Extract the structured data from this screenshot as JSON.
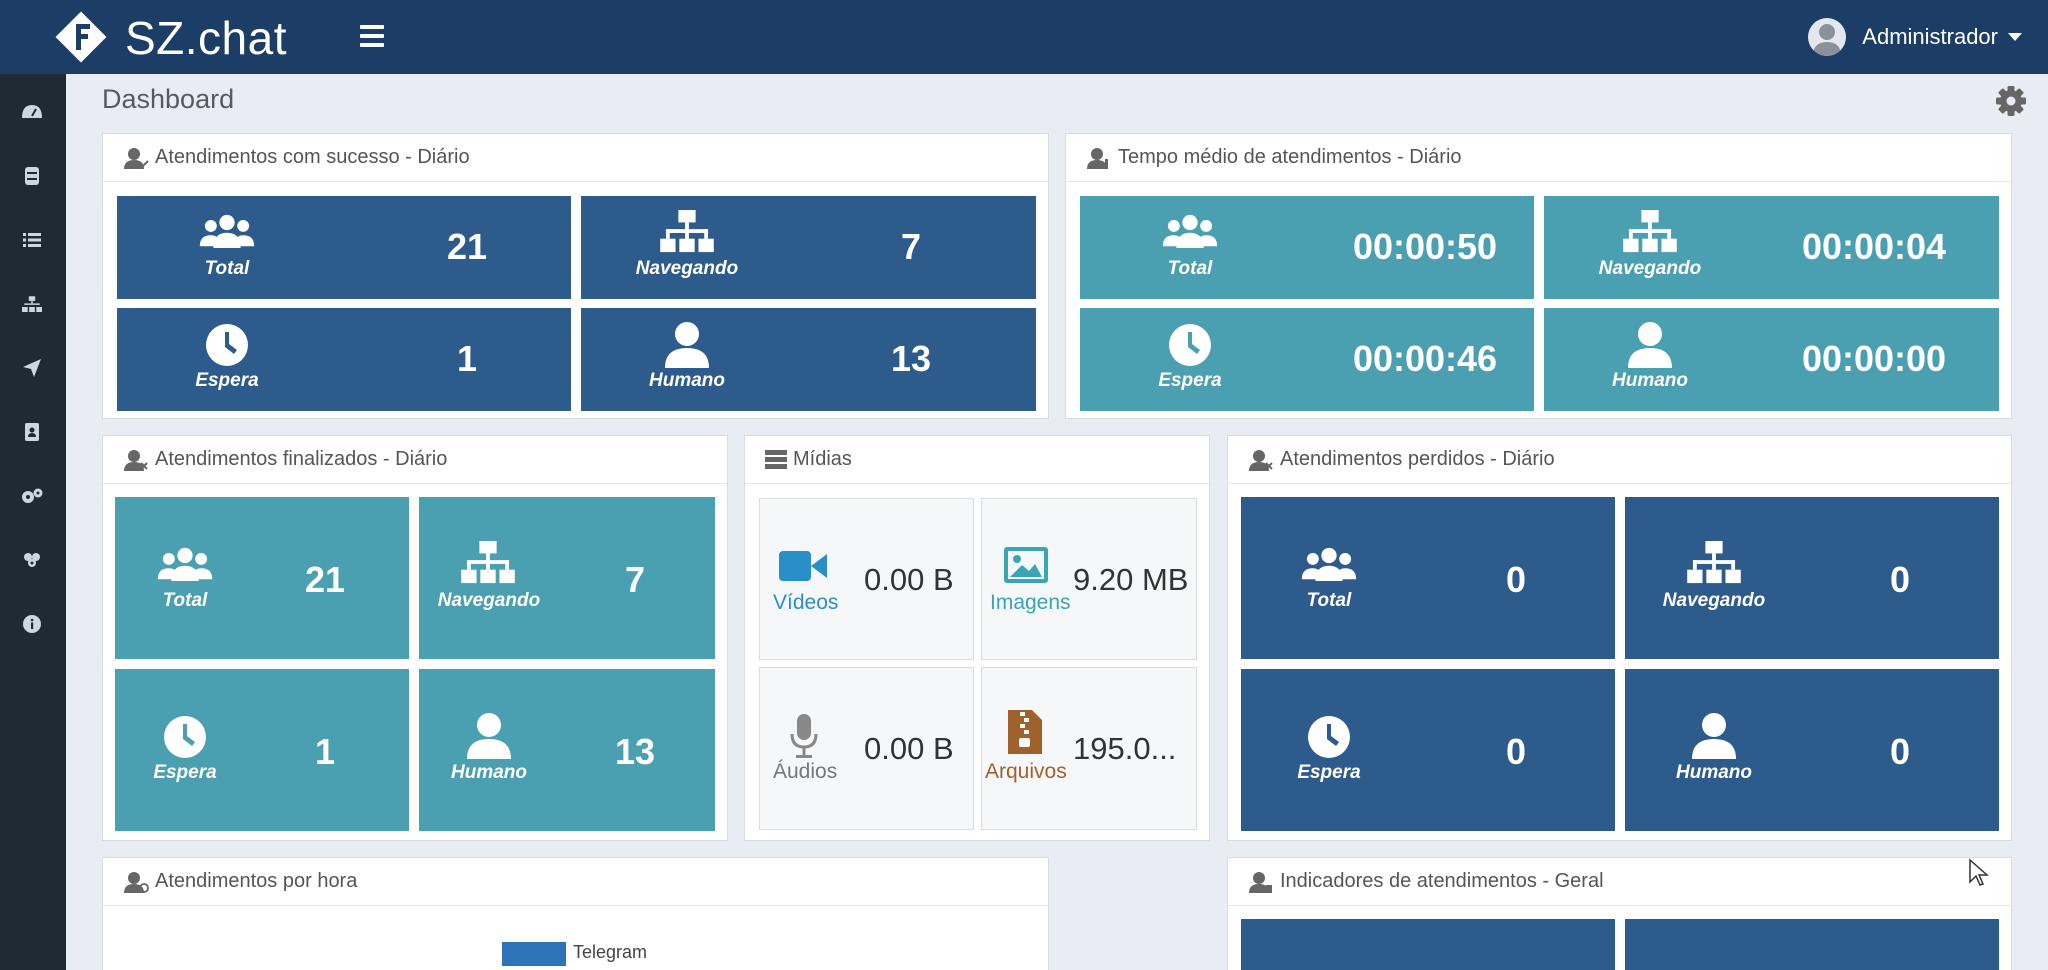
{
  "app": {
    "brand": "SZ.chat",
    "user": "Administrador"
  },
  "page": {
    "title": "Dashboard"
  },
  "sidebar": {
    "icons": [
      "dashboard-icon",
      "database-icon",
      "list-icon",
      "sitemap-icon",
      "send-icon",
      "contact-book-icon",
      "cogs-icon",
      "group-icon",
      "info-icon"
    ]
  },
  "panels": {
    "sucesso": {
      "title": "Atendimentos com sucesso - Diário",
      "tiles": [
        {
          "label": "Total",
          "value": "21"
        },
        {
          "label": "Navegando",
          "value": "7"
        },
        {
          "label": "Espera",
          "value": "1"
        },
        {
          "label": "Humano",
          "value": "13"
        }
      ]
    },
    "tempo": {
      "title": "Tempo médio de atendimentos - Diário",
      "tiles": [
        {
          "label": "Total",
          "value": "00:00:50"
        },
        {
          "label": "Navegando",
          "value": "00:00:04"
        },
        {
          "label": "Espera",
          "value": "00:00:46"
        },
        {
          "label": "Humano",
          "value": "00:00:00"
        }
      ]
    },
    "finalizados": {
      "title": "Atendimentos finalizados - Diário",
      "tiles": [
        {
          "label": "Total",
          "value": "21"
        },
        {
          "label": "Navegando",
          "value": "7"
        },
        {
          "label": "Espera",
          "value": "1"
        },
        {
          "label": "Humano",
          "value": "13"
        }
      ]
    },
    "midias": {
      "title": "Mídias",
      "items": [
        {
          "label": "Vídeos",
          "value": "0.00 B",
          "color": "#2a8fc7"
        },
        {
          "label": "Imagens",
          "value": "9.20 MB",
          "color": "#38a6b3"
        },
        {
          "label": "Áudios",
          "value": "0.00 B",
          "color": "#777777"
        },
        {
          "label": "Arquivos",
          "value": "195.0...",
          "color": "#a0622d"
        }
      ]
    },
    "perdidos": {
      "title": "Atendimentos perdidos - Diário",
      "tiles": [
        {
          "label": "Total",
          "value": "0"
        },
        {
          "label": "Navegando",
          "value": "0"
        },
        {
          "label": "Espera",
          "value": "0"
        },
        {
          "label": "Humano",
          "value": "0"
        }
      ]
    },
    "porhora": {
      "title": "Atendimentos por hora",
      "legend": "Telegram",
      "legend_color": "#2e73b8"
    },
    "indicadores": {
      "title": "Indicadores de atendimentos - Geral"
    }
  },
  "colors": {
    "topbar": "#1c3d66",
    "sidebar": "#202a33",
    "tile_dark": "#2d5b8c",
    "tile_teal": "#4aa0b0"
  }
}
